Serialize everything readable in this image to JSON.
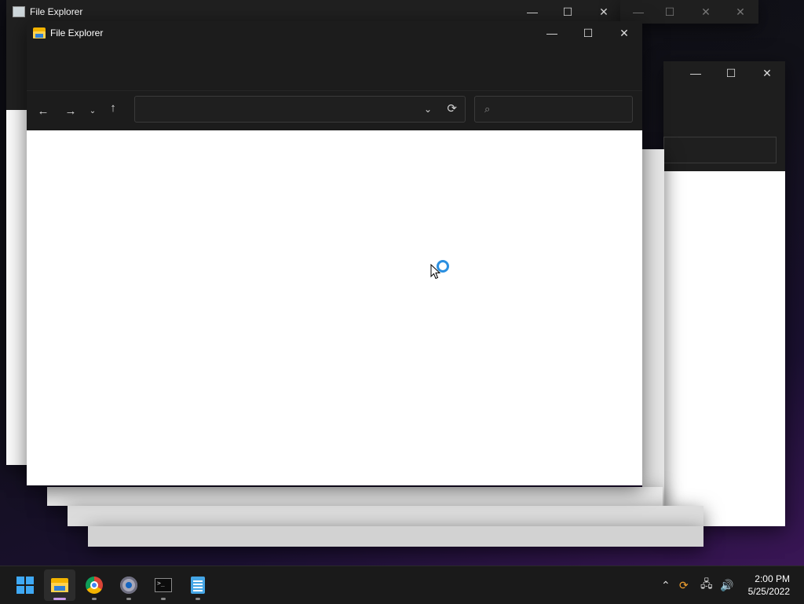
{
  "windows": {
    "back_title": "File Explorer",
    "main_title": "File Explorer"
  },
  "main": {
    "address_value": "",
    "search_placeholder": ""
  },
  "icons": {
    "back": "arrow-left-icon",
    "forward": "arrow-right-icon",
    "recent": "chevron-down-icon",
    "up": "arrow-up-icon",
    "refresh": "refresh-icon",
    "search": "search-icon",
    "minimize": "minimize-icon",
    "maximize": "maximize-icon",
    "close": "close-icon"
  },
  "taskbar": {
    "apps": [
      "Start",
      "File Explorer",
      "Google Chrome",
      "Settings",
      "Terminal",
      "Notepad"
    ],
    "time": "2:00 PM",
    "date": "5/25/2022"
  },
  "colors": {
    "accent": "#2b8fe0",
    "titlebar": "#1c1c1c",
    "active_indicator": "#c79ae8"
  }
}
